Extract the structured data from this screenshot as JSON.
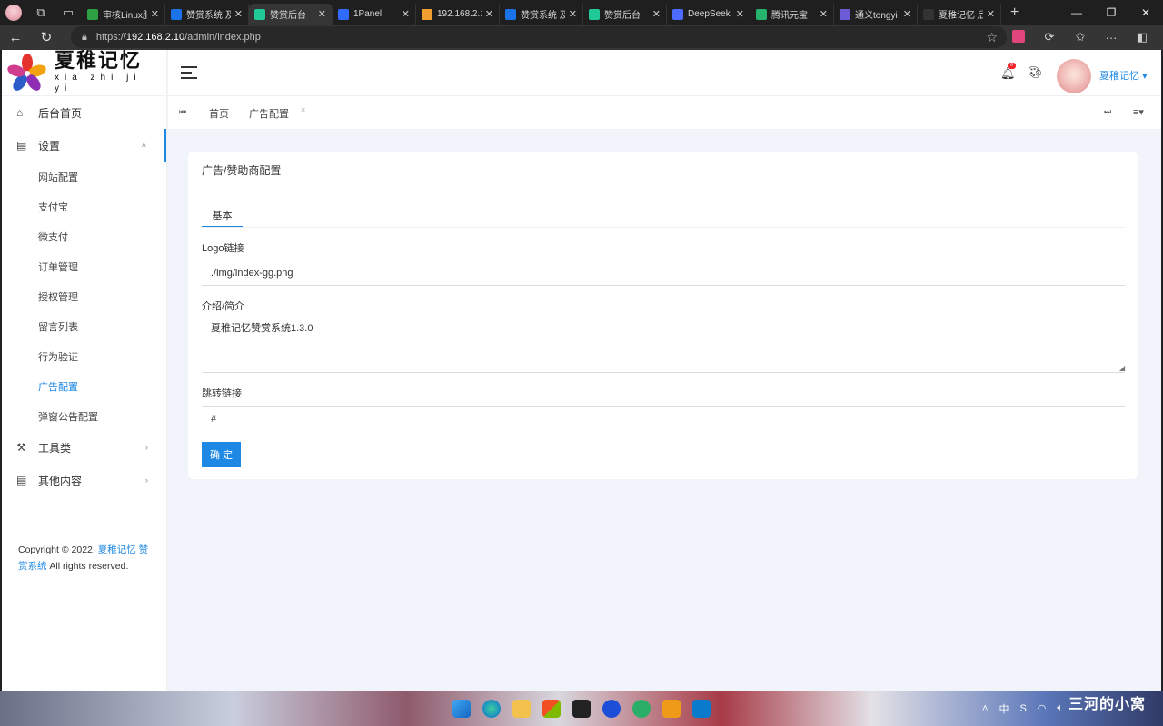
{
  "browser": {
    "tabs": [
      {
        "label": "审核Linux服",
        "color": "#2ea043",
        "active": false
      },
      {
        "label": "赞赏系统 及",
        "color": "#1a73e8",
        "active": false
      },
      {
        "label": "赞赏后台",
        "color": "#20c997",
        "active": true
      },
      {
        "label": "1Panel",
        "color": "#2f6bff",
        "active": false
      },
      {
        "label": "192.168.2.1",
        "color": "#f0a030",
        "active": false
      },
      {
        "label": "赞赏系统 及",
        "color": "#1a73e8",
        "active": false
      },
      {
        "label": "赞赏后台",
        "color": "#20c997",
        "active": false
      },
      {
        "label": "DeepSeek",
        "color": "#4d6bfe",
        "active": false
      },
      {
        "label": "腾讯元宝",
        "color": "#26b36b",
        "active": false
      },
      {
        "label": "通义tongyi",
        "color": "#6b5bd6",
        "active": false
      },
      {
        "label": "夏稚记忆 后",
        "color": "#333333",
        "active": false
      }
    ],
    "url_prefix": "https://",
    "url_host": "192.168.2.10",
    "url_path": "/admin/index.php"
  },
  "sidebar": {
    "logo_text": "夏稚记忆",
    "logo_pinyin": "xia zhi ji yi",
    "home": "后台首页",
    "settings": "设置",
    "settings_items": [
      "网站配置",
      "支付宝",
      "微支付",
      "订单管理",
      "授权管理",
      "留言列表",
      "行为验证",
      "广告配置",
      "弹窗公告配置"
    ],
    "active_item": "广告配置",
    "tools": "工具类",
    "other": "其他内容",
    "copyright_prefix": "Copyright © 2022.",
    "copyright_link": "夏稚记忆 赞赏系统",
    "copyright_suffix": "All rights reserved."
  },
  "header": {
    "notification_count": "6",
    "user_name": "夏稚记忆"
  },
  "pagetabs": {
    "home": "首页",
    "current": "广告配置"
  },
  "form": {
    "card_title": "广告/赞助商配置",
    "tab_basic": "基本",
    "logo_label": "Logo链接",
    "logo_value": "./img/index-gg.png",
    "intro_label": "介绍/简介",
    "intro_value": "夏稚记忆赞赏系统1.3.0",
    "link_label": "跳转链接",
    "link_value": "#",
    "submit_label": "确 定"
  },
  "taskbar": {
    "ime": "中",
    "watermark": "三河的小窝"
  }
}
